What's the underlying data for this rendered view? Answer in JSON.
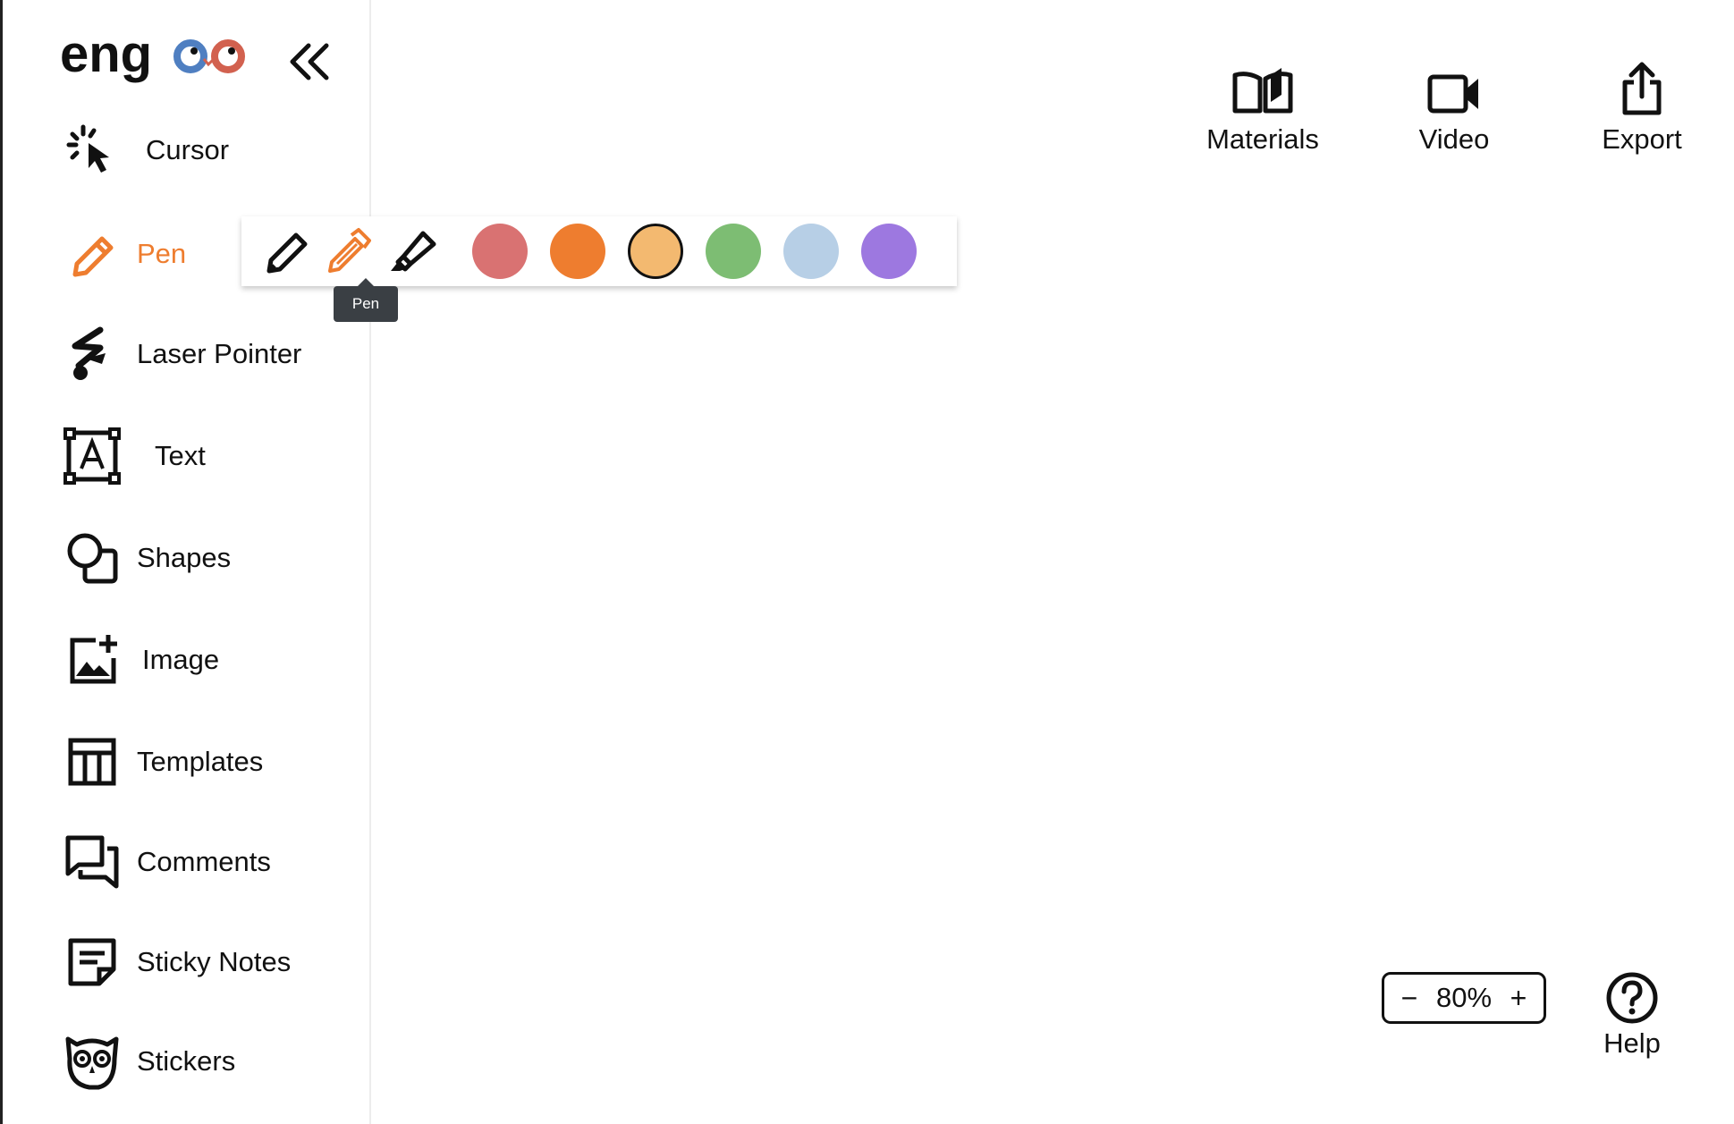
{
  "app": {
    "logo_text": "engoo",
    "collapse_icon": "double-chevron-left-icon"
  },
  "sidebar": {
    "items": [
      {
        "id": "cursor",
        "label": "Cursor",
        "icon": "cursor-click-icon"
      },
      {
        "id": "pen",
        "label": "Pen",
        "icon": "pen-icon",
        "active": true
      },
      {
        "id": "laser",
        "label": "Laser Pointer",
        "icon": "laser-pointer-icon"
      },
      {
        "id": "text",
        "label": "Text",
        "icon": "text-box-icon"
      },
      {
        "id": "shapes",
        "label": "Shapes",
        "icon": "shapes-icon"
      },
      {
        "id": "image",
        "label": "Image",
        "icon": "image-add-icon"
      },
      {
        "id": "templates",
        "label": "Templates",
        "icon": "templates-icon"
      },
      {
        "id": "comments",
        "label": "Comments",
        "icon": "comments-icon"
      },
      {
        "id": "sticky",
        "label": "Sticky Notes",
        "icon": "sticky-note-icon"
      },
      {
        "id": "stickers",
        "label": "Stickers",
        "icon": "owl-sticker-icon"
      }
    ]
  },
  "pen_popover": {
    "tools": [
      {
        "name": "pencil",
        "icon": "pencil-icon"
      },
      {
        "name": "pen",
        "icon": "double-pen-icon",
        "selected": true,
        "color": "#ee7d2f"
      },
      {
        "name": "highlighter",
        "icon": "highlighter-icon"
      }
    ],
    "colors": [
      "#d97272",
      "#ee7d2f",
      "#f3b970",
      "#7dbd73",
      "#b7cfe6",
      "#9d78e0"
    ],
    "selected_color": "#f3b970",
    "tooltip": "Pen"
  },
  "top_actions": {
    "materials": {
      "label": "Materials",
      "icon": "book-open-icon"
    },
    "video": {
      "label": "Video",
      "icon": "video-camera-icon"
    },
    "export": {
      "label": "Export",
      "icon": "share-export-icon"
    }
  },
  "zoom": {
    "minus": "−",
    "value": "80%",
    "plus": "+"
  },
  "help": {
    "label": "Help",
    "icon": "question-circle-icon"
  },
  "colors": {
    "accent": "#ee7d2f",
    "logo_blue": "#4f7fc1",
    "logo_red": "#d2614f"
  }
}
